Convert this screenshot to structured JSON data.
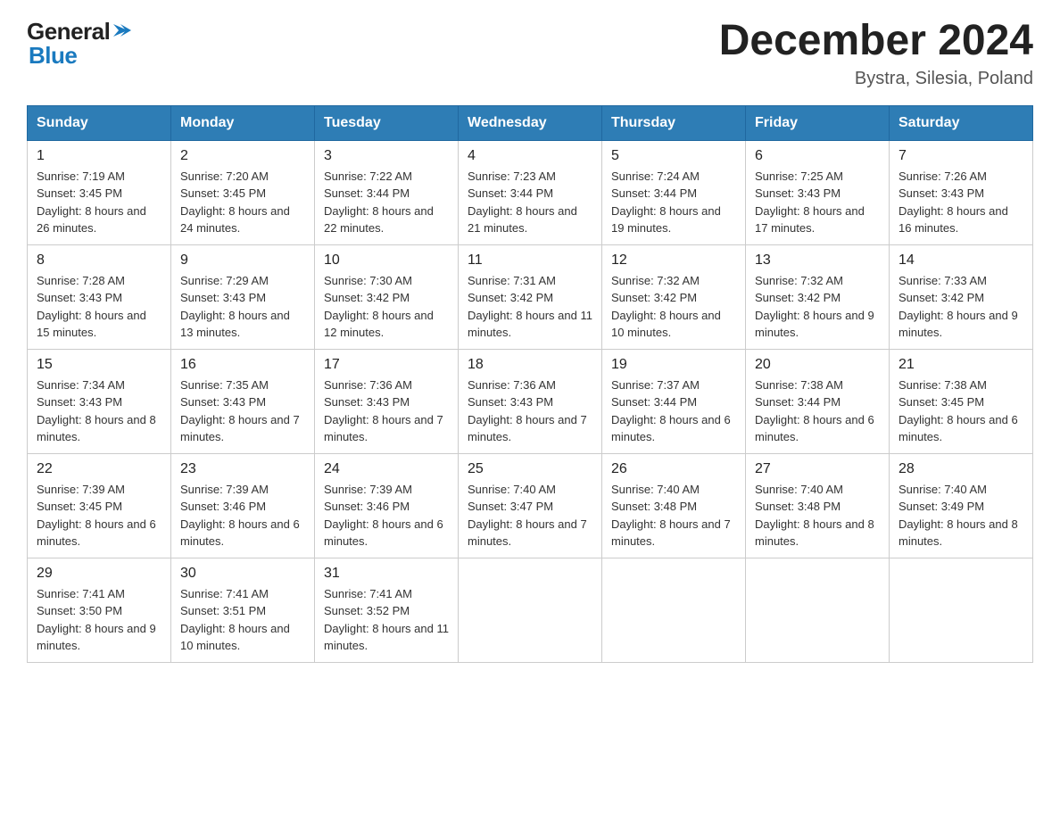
{
  "logo": {
    "text_general": "General",
    "text_blue": "Blue",
    "arrow_color": "#1a7abf"
  },
  "header": {
    "title": "December 2024",
    "subtitle": "Bystra, Silesia, Poland"
  },
  "weekdays": [
    "Sunday",
    "Monday",
    "Tuesday",
    "Wednesday",
    "Thursday",
    "Friday",
    "Saturday"
  ],
  "weeks": [
    [
      {
        "day": "1",
        "sunrise": "7:19 AM",
        "sunset": "3:45 PM",
        "daylight": "8 hours and 26 minutes."
      },
      {
        "day": "2",
        "sunrise": "7:20 AM",
        "sunset": "3:45 PM",
        "daylight": "8 hours and 24 minutes."
      },
      {
        "day": "3",
        "sunrise": "7:22 AM",
        "sunset": "3:44 PM",
        "daylight": "8 hours and 22 minutes."
      },
      {
        "day": "4",
        "sunrise": "7:23 AM",
        "sunset": "3:44 PM",
        "daylight": "8 hours and 21 minutes."
      },
      {
        "day": "5",
        "sunrise": "7:24 AM",
        "sunset": "3:44 PM",
        "daylight": "8 hours and 19 minutes."
      },
      {
        "day": "6",
        "sunrise": "7:25 AM",
        "sunset": "3:43 PM",
        "daylight": "8 hours and 17 minutes."
      },
      {
        "day": "7",
        "sunrise": "7:26 AM",
        "sunset": "3:43 PM",
        "daylight": "8 hours and 16 minutes."
      }
    ],
    [
      {
        "day": "8",
        "sunrise": "7:28 AM",
        "sunset": "3:43 PM",
        "daylight": "8 hours and 15 minutes."
      },
      {
        "day": "9",
        "sunrise": "7:29 AM",
        "sunset": "3:43 PM",
        "daylight": "8 hours and 13 minutes."
      },
      {
        "day": "10",
        "sunrise": "7:30 AM",
        "sunset": "3:42 PM",
        "daylight": "8 hours and 12 minutes."
      },
      {
        "day": "11",
        "sunrise": "7:31 AM",
        "sunset": "3:42 PM",
        "daylight": "8 hours and 11 minutes."
      },
      {
        "day": "12",
        "sunrise": "7:32 AM",
        "sunset": "3:42 PM",
        "daylight": "8 hours and 10 minutes."
      },
      {
        "day": "13",
        "sunrise": "7:32 AM",
        "sunset": "3:42 PM",
        "daylight": "8 hours and 9 minutes."
      },
      {
        "day": "14",
        "sunrise": "7:33 AM",
        "sunset": "3:42 PM",
        "daylight": "8 hours and 9 minutes."
      }
    ],
    [
      {
        "day": "15",
        "sunrise": "7:34 AM",
        "sunset": "3:43 PM",
        "daylight": "8 hours and 8 minutes."
      },
      {
        "day": "16",
        "sunrise": "7:35 AM",
        "sunset": "3:43 PM",
        "daylight": "8 hours and 7 minutes."
      },
      {
        "day": "17",
        "sunrise": "7:36 AM",
        "sunset": "3:43 PM",
        "daylight": "8 hours and 7 minutes."
      },
      {
        "day": "18",
        "sunrise": "7:36 AM",
        "sunset": "3:43 PM",
        "daylight": "8 hours and 7 minutes."
      },
      {
        "day": "19",
        "sunrise": "7:37 AM",
        "sunset": "3:44 PM",
        "daylight": "8 hours and 6 minutes."
      },
      {
        "day": "20",
        "sunrise": "7:38 AM",
        "sunset": "3:44 PM",
        "daylight": "8 hours and 6 minutes."
      },
      {
        "day": "21",
        "sunrise": "7:38 AM",
        "sunset": "3:45 PM",
        "daylight": "8 hours and 6 minutes."
      }
    ],
    [
      {
        "day": "22",
        "sunrise": "7:39 AM",
        "sunset": "3:45 PM",
        "daylight": "8 hours and 6 minutes."
      },
      {
        "day": "23",
        "sunrise": "7:39 AM",
        "sunset": "3:46 PM",
        "daylight": "8 hours and 6 minutes."
      },
      {
        "day": "24",
        "sunrise": "7:39 AM",
        "sunset": "3:46 PM",
        "daylight": "8 hours and 6 minutes."
      },
      {
        "day": "25",
        "sunrise": "7:40 AM",
        "sunset": "3:47 PM",
        "daylight": "8 hours and 7 minutes."
      },
      {
        "day": "26",
        "sunrise": "7:40 AM",
        "sunset": "3:48 PM",
        "daylight": "8 hours and 7 minutes."
      },
      {
        "day": "27",
        "sunrise": "7:40 AM",
        "sunset": "3:48 PM",
        "daylight": "8 hours and 8 minutes."
      },
      {
        "day": "28",
        "sunrise": "7:40 AM",
        "sunset": "3:49 PM",
        "daylight": "8 hours and 8 minutes."
      }
    ],
    [
      {
        "day": "29",
        "sunrise": "7:41 AM",
        "sunset": "3:50 PM",
        "daylight": "8 hours and 9 minutes."
      },
      {
        "day": "30",
        "sunrise": "7:41 AM",
        "sunset": "3:51 PM",
        "daylight": "8 hours and 10 minutes."
      },
      {
        "day": "31",
        "sunrise": "7:41 AM",
        "sunset": "3:52 PM",
        "daylight": "8 hours and 11 minutes."
      },
      null,
      null,
      null,
      null
    ]
  ]
}
